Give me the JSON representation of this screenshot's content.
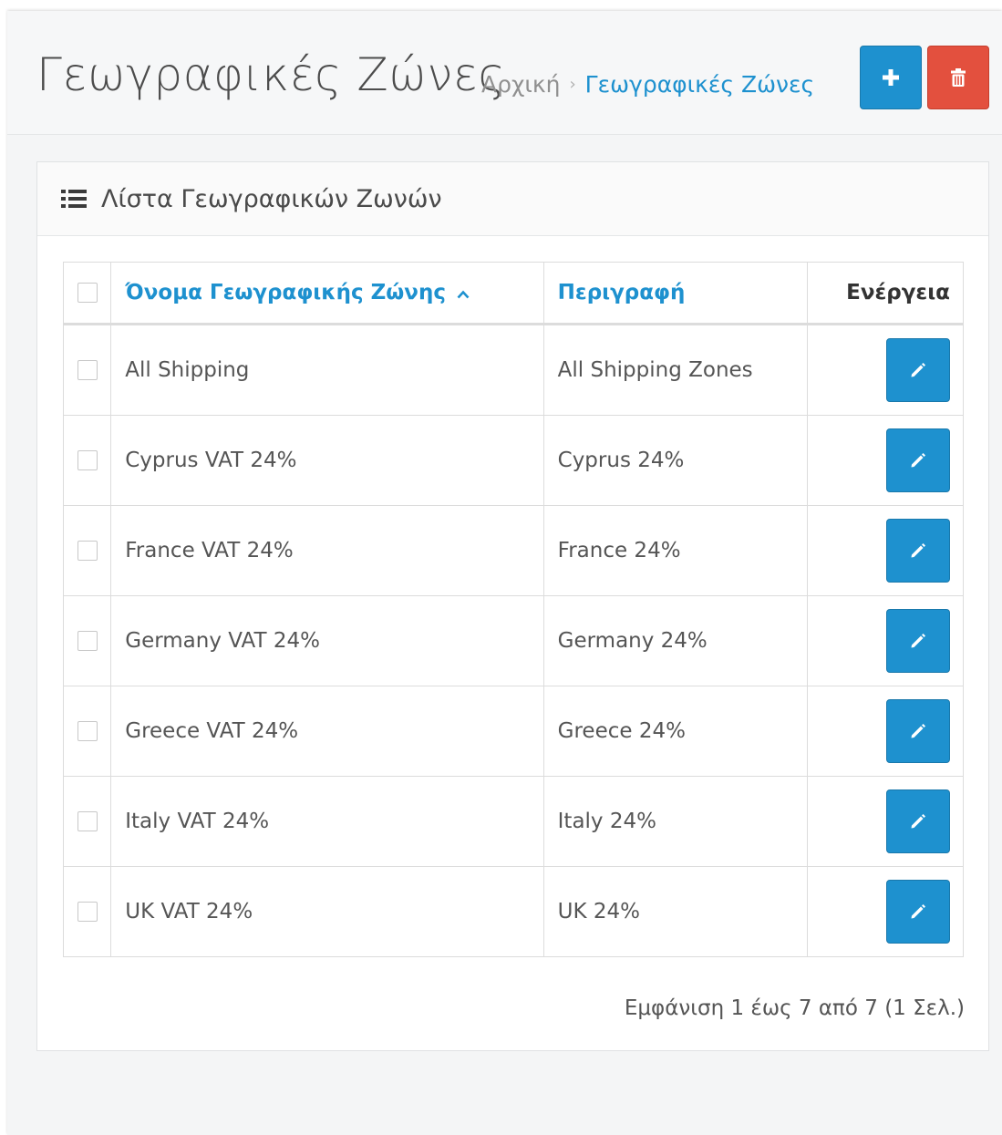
{
  "header": {
    "title": "Γεωγραφικές Ζώνες",
    "breadcrumb": {
      "home": "Αρχική",
      "separator": "›",
      "current": "Γεωγραφικές Ζώνες"
    },
    "add_icon": "plus-icon",
    "delete_icon": "trash-icon"
  },
  "panel": {
    "title": "Λίστα Γεωγραφικών Ζωνών",
    "icon": "list-icon"
  },
  "table": {
    "columns": {
      "name": "Όνομα Γεωγραφικής Ζώνης",
      "description": "Περιγραφή",
      "action": "Ενέργεια"
    },
    "sort_indicator": "caret-up-icon",
    "rows": [
      {
        "name": "All Shipping",
        "description": "All Shipping Zones"
      },
      {
        "name": "Cyprus VAT 24%",
        "description": "Cyprus 24%"
      },
      {
        "name": "France VAT 24%",
        "description": "France 24%"
      },
      {
        "name": "Germany VAT 24%",
        "description": "Germany 24%"
      },
      {
        "name": "Greece VAT 24%",
        "description": "Greece 24%"
      },
      {
        "name": "Italy VAT 24%",
        "description": "Italy 24%"
      },
      {
        "name": "UK VAT 24%",
        "description": "UK 24%"
      }
    ]
  },
  "pagination": {
    "summary": "Εμφάνιση 1 έως 7 από 7 (1 Σελ.)"
  },
  "colors": {
    "primary": "#1e91cf",
    "danger": "#e3503e"
  }
}
